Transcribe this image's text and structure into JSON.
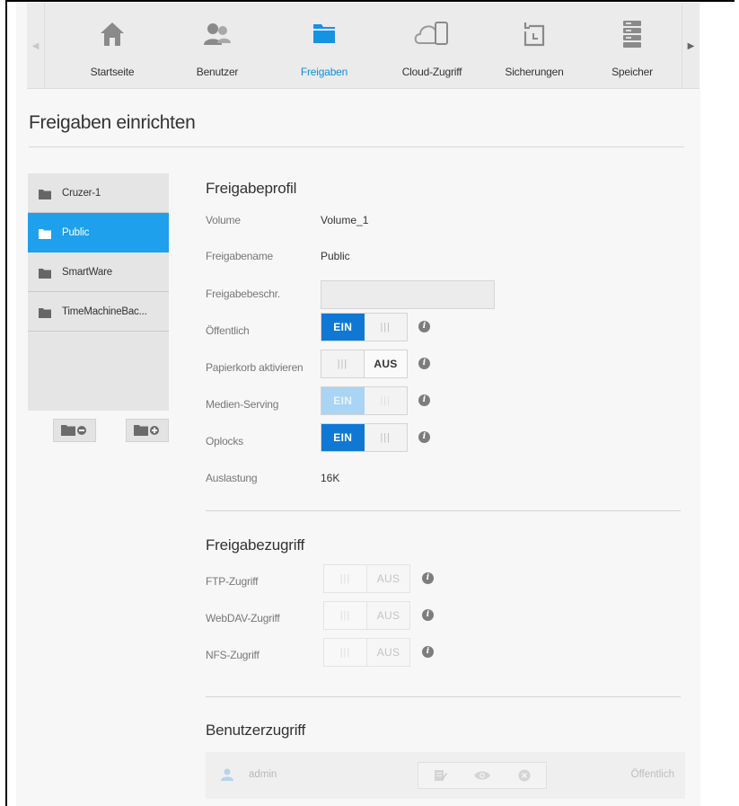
{
  "nav": {
    "items": [
      {
        "label": "Startseite",
        "icon": "home-icon"
      },
      {
        "label": "Benutzer",
        "icon": "users-icon"
      },
      {
        "label": "Freigaben",
        "icon": "folder-icon",
        "active": true
      },
      {
        "label": "Cloud-Zugriff",
        "icon": "cloud-device-icon"
      },
      {
        "label": "Sicherungen",
        "icon": "backup-icon"
      },
      {
        "label": "Speicher",
        "icon": "storage-icon"
      }
    ]
  },
  "page": {
    "title": "Freigaben einrichten"
  },
  "shares": {
    "items": [
      {
        "label": "Cruzer-1"
      },
      {
        "label": "Public"
      },
      {
        "label": "SmartWare"
      },
      {
        "label": "TimeMachineBac..."
      }
    ],
    "selected": "Public"
  },
  "profile": {
    "title": "Freigabeprofil",
    "volume_label": "Volume",
    "volume_value": "Volume_1",
    "name_label": "Freigabename",
    "name_value": "Public",
    "desc_label": "Freigabebeschr.",
    "desc_value": "",
    "public_label": "Öffentlich",
    "recycle_label": "Papierkorb aktivieren",
    "media_label": "Medien-Serving",
    "oplocks_label": "Oplocks",
    "usage_label": "Auslastung",
    "usage_value": "16K"
  },
  "toggles": {
    "on_text": "EIN",
    "off_text": "AUS",
    "grip": "|||"
  },
  "access": {
    "title": "Freigabezugriff",
    "ftp_label": "FTP-Zugriff",
    "webdav_label": "WebDAV-Zugriff",
    "nfs_label": "NFS-Zugriff"
  },
  "user_access": {
    "title": "Benutzerzugriff",
    "users": [
      {
        "name": "admin",
        "status": "Öffentlich"
      }
    ]
  },
  "colors": {
    "accent": "#0f78d4",
    "selected_row": "#1ea0ec",
    "active_nav": "#0f8fe0"
  }
}
